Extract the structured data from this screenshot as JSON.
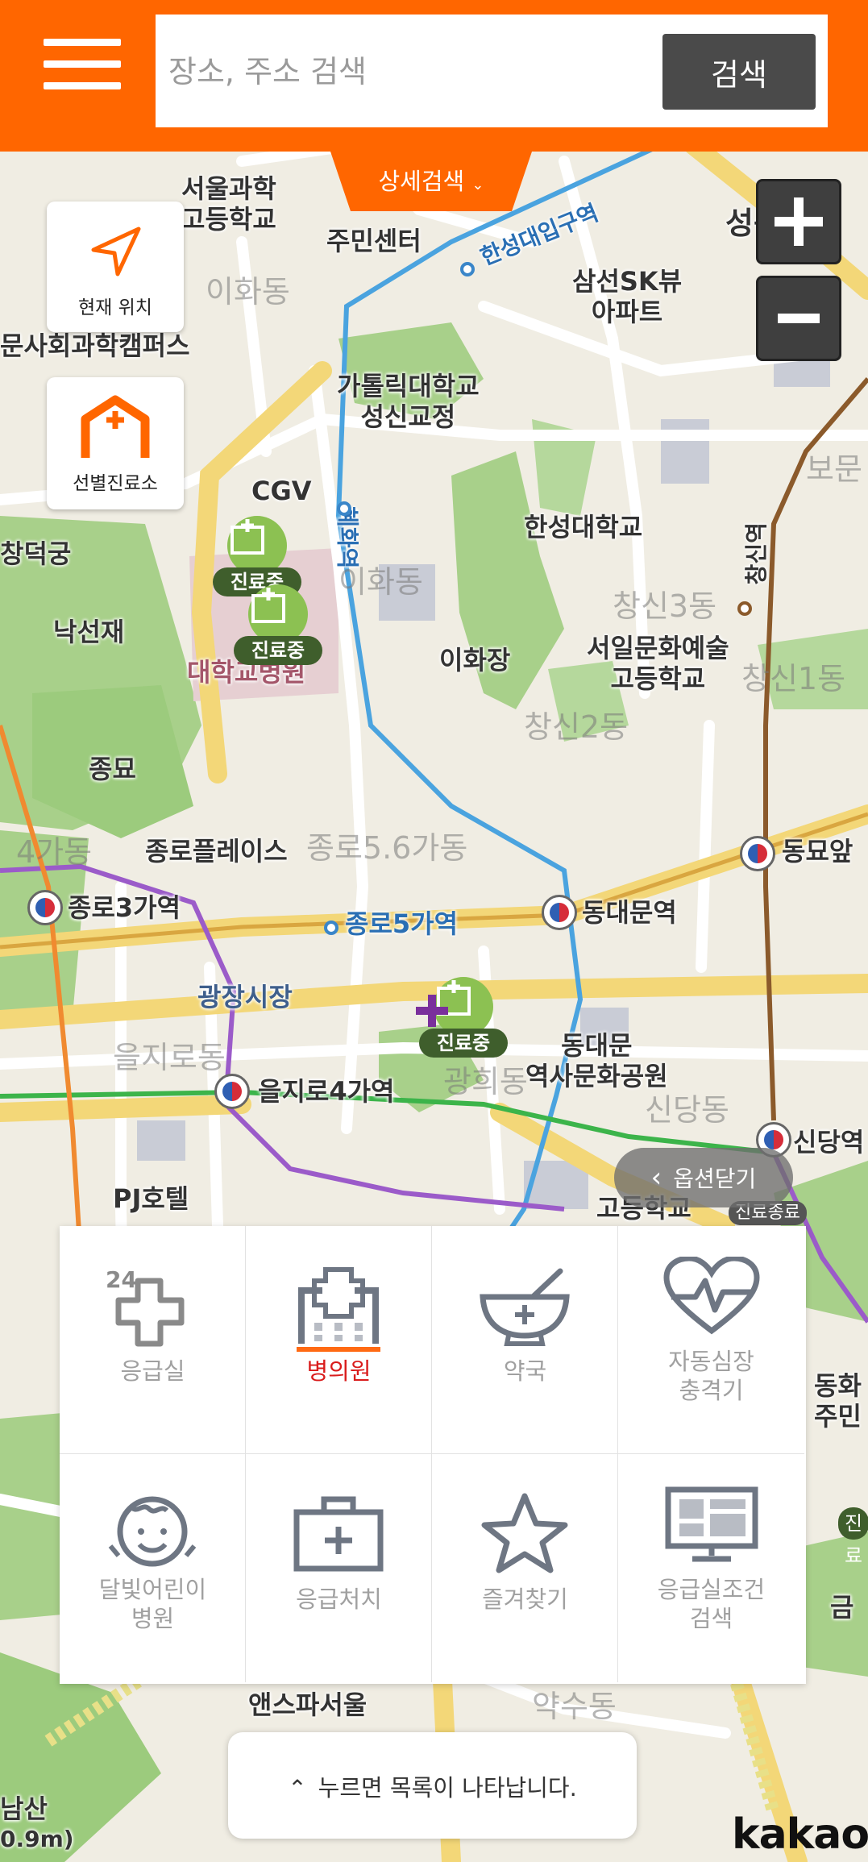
{
  "header": {
    "menu_icon": "hamburger-menu-icon",
    "search_placeholder": "장소, 주소 검색",
    "search_button": "검색",
    "detail_search": "상세검색"
  },
  "left_buttons": {
    "current_location": "현재 위치",
    "screening_clinic": "선별진료소"
  },
  "map": {
    "labels": {
      "seoul_science_hs": "서울과학\n고등학교",
      "comm_center": "주민센터",
      "humanities_campus": "문사회과학캠퍼스",
      "samsun_sk": "삼선SK뷰\n아파트",
      "catholic_univ": "가톨릭대학교\n성신교정",
      "cgv": "CGV",
      "changdeokgung": "창덕궁",
      "hansung_univ": "한성대학교",
      "nakseonjae": "낙선재",
      "ihwajang": "이화장",
      "seoil_arts_hs": "서일문화예술\n고등학교",
      "univ_hospital": "대학교병원",
      "jongmyo": "종묘",
      "jongno_place": "종로플레이스",
      "dongmyo": "동묘앞",
      "jongno3": "종로3가역",
      "jongno5": "종로5가역",
      "dongdaemun": "동대문역",
      "gwangjang": "광장시장",
      "euljiro4": "을지로4가역",
      "ddp": "동대문\n역사문화공원",
      "sindang": "신당역",
      "pj_hotel": "PJ호텔",
      "ansfa": "앤스파서울",
      "hansung_station": "한성대입구역",
      "hyehwa": "혜화역",
      "changsin": "창신역",
      "seongbuk": "성북구",
      "faint_ihwa": "이화동",
      "faint_changsin2": "창신2동",
      "faint_changsin3": "창신3동",
      "faint_jongno56": "종로5.6가동",
      "faint_jongno4": "4가동",
      "faint_euljiro": "을지로동",
      "faint_sindang": "신당동",
      "faint_yaksu": "약수동",
      "faint_bomun": "보문",
      "faint_changsin1": "창신1동",
      "comm_center2": "동화\n주민",
      "gwanghui": "광희동",
      "high_school": "고등학교",
      "geum": "금",
      "samsan": "남산",
      "distance": "0.9m)"
    },
    "pins": {
      "pin1_tag": "진료중",
      "pin2_tag": "진료중",
      "pin3_tag": "진료중",
      "pin4_tag": "진료종료",
      "pin5_tag": "진료"
    }
  },
  "options": {
    "close_label": "옵션닫기",
    "items": [
      {
        "label": "응급실",
        "icon": "emergency-24-icon"
      },
      {
        "label": "병의원",
        "icon": "hospital-icon",
        "active": true
      },
      {
        "label": "약국",
        "icon": "pharmacy-bowl-icon"
      },
      {
        "label": "자동심장\n충격기",
        "icon": "defibrillator-heart-icon"
      },
      {
        "label": "달빛어린이\n병원",
        "icon": "child-face-icon"
      },
      {
        "label": "응급처치",
        "icon": "first-aid-kit-icon"
      },
      {
        "label": "즐겨찾기",
        "icon": "star-icon"
      },
      {
        "label": "응급실조건\n검색",
        "icon": "monitor-search-icon"
      }
    ]
  },
  "bottom": {
    "list_toggle": "누르면 목록이 나타납니다.",
    "brand": "kakao"
  },
  "colors": {
    "accent": "#ff6600",
    "active_text": "#d91c1c",
    "pin_green": "#8cc152",
    "pin_tag": "#3f5e2c"
  }
}
